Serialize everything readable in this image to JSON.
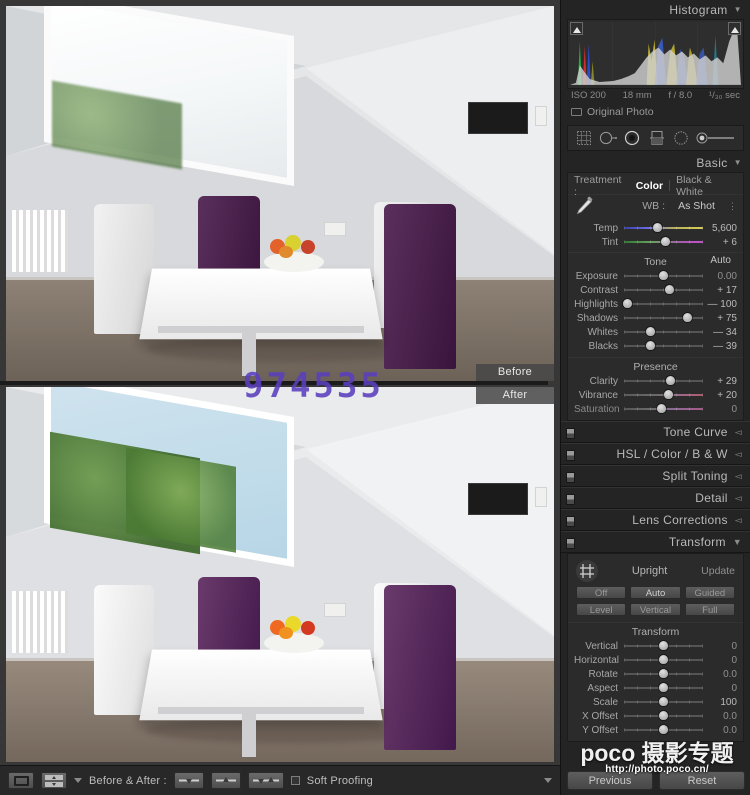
{
  "histogram": {
    "title": "Histogram",
    "iso": "ISO 200",
    "focal": "18 mm",
    "aperture": "f / 8.0",
    "shutter": "¹/₃₀ sec",
    "original_photo": "Original Photo"
  },
  "tools": [
    {
      "name": "crop-overlay-tool",
      "label": "Crop Overlay"
    },
    {
      "name": "spot-removal-tool",
      "label": "Spot Removal"
    },
    {
      "name": "red-eye-correction-tool",
      "label": "Red Eye Correction"
    },
    {
      "name": "graduated-filter-tool",
      "label": "Graduated Filter"
    },
    {
      "name": "radial-filter-tool",
      "label": "Radial Filter"
    },
    {
      "name": "adjustment-brush-tool",
      "label": "Adjustment Brush"
    }
  ],
  "basic": {
    "title": "Basic",
    "treatment_label": "Treatment :",
    "treatment_options": [
      "Color",
      "Black & White"
    ],
    "treatment_selected": "Color",
    "wb_label": "WB :",
    "wb_value": "As Shot",
    "white_balance": [
      {
        "label": "Temp",
        "value": "5,600",
        "pos": 42,
        "rail": "temp"
      },
      {
        "label": "Tint",
        "value": "+ 6",
        "pos": 53,
        "rail": "tint"
      }
    ],
    "tone_title": "Tone",
    "auto_label": "Auto",
    "tone": [
      {
        "label": "Exposure",
        "value": "0.00",
        "pos": 50
      },
      {
        "label": "Contrast",
        "value": "+ 17",
        "pos": 57
      },
      {
        "label": "Highlights",
        "value": "— 100",
        "pos": 4
      },
      {
        "label": "Shadows",
        "value": "+ 75",
        "pos": 81
      },
      {
        "label": "Whites",
        "value": "— 34",
        "pos": 34
      },
      {
        "label": "Blacks",
        "value": "— 39",
        "pos": 33
      }
    ],
    "presence_title": "Presence",
    "presence": [
      {
        "label": "Clarity",
        "value": "+ 29",
        "pos": 59,
        "rail": ""
      },
      {
        "label": "Vibrance",
        "value": "+ 20",
        "pos": 56,
        "rail": "vib"
      },
      {
        "label": "Saturation",
        "value": "0",
        "pos": 48,
        "rail": "sat"
      }
    ]
  },
  "panels": [
    {
      "name": "tone-curve",
      "label": "Tone Curve"
    },
    {
      "name": "hsl-color-bw",
      "label": "HSL / Color / B & W"
    },
    {
      "name": "split-toning",
      "label": "Split Toning"
    },
    {
      "name": "detail",
      "label": "Detail"
    },
    {
      "name": "lens-corrections",
      "label": "Lens Corrections"
    }
  ],
  "transform": {
    "title": "Transform",
    "upright_label": "Upright",
    "update_label": "Update",
    "upright_buttons": [
      "Off",
      "Auto",
      "Guided",
      "Level",
      "Vertical",
      "Full"
    ],
    "group_title": "Transform",
    "sliders": [
      {
        "label": "Vertical",
        "value": "0",
        "pos": 50
      },
      {
        "label": "Horizontal",
        "value": "0",
        "pos": 50
      },
      {
        "label": "Rotate",
        "value": "0.0",
        "pos": 50
      },
      {
        "label": "Aspect",
        "value": "0",
        "pos": 50
      },
      {
        "label": "Scale",
        "value": "100",
        "pos": 50
      },
      {
        "label": "X Offset",
        "value": "0.0",
        "pos": 50
      },
      {
        "label": "Y Offset",
        "value": "0.0",
        "pos": 50
      }
    ]
  },
  "bottom_buttons": {
    "previous": "Previous",
    "reset": "Reset"
  },
  "toolbar": {
    "before_after_label": "Before & After :",
    "soft_proofing_label": "Soft Proofing"
  },
  "preview": {
    "before_label": "Before",
    "after_label": "After",
    "watermark_digits": "974535"
  },
  "watermark": {
    "brand": "poco 摄影专题",
    "url": "http://photo.poco.cn/"
  },
  "colors": {
    "panel_bg": "#242424",
    "block_bg": "#2b2b2b",
    "text": "#b4b4b4",
    "accent_watermark": "#5b3fbe"
  }
}
